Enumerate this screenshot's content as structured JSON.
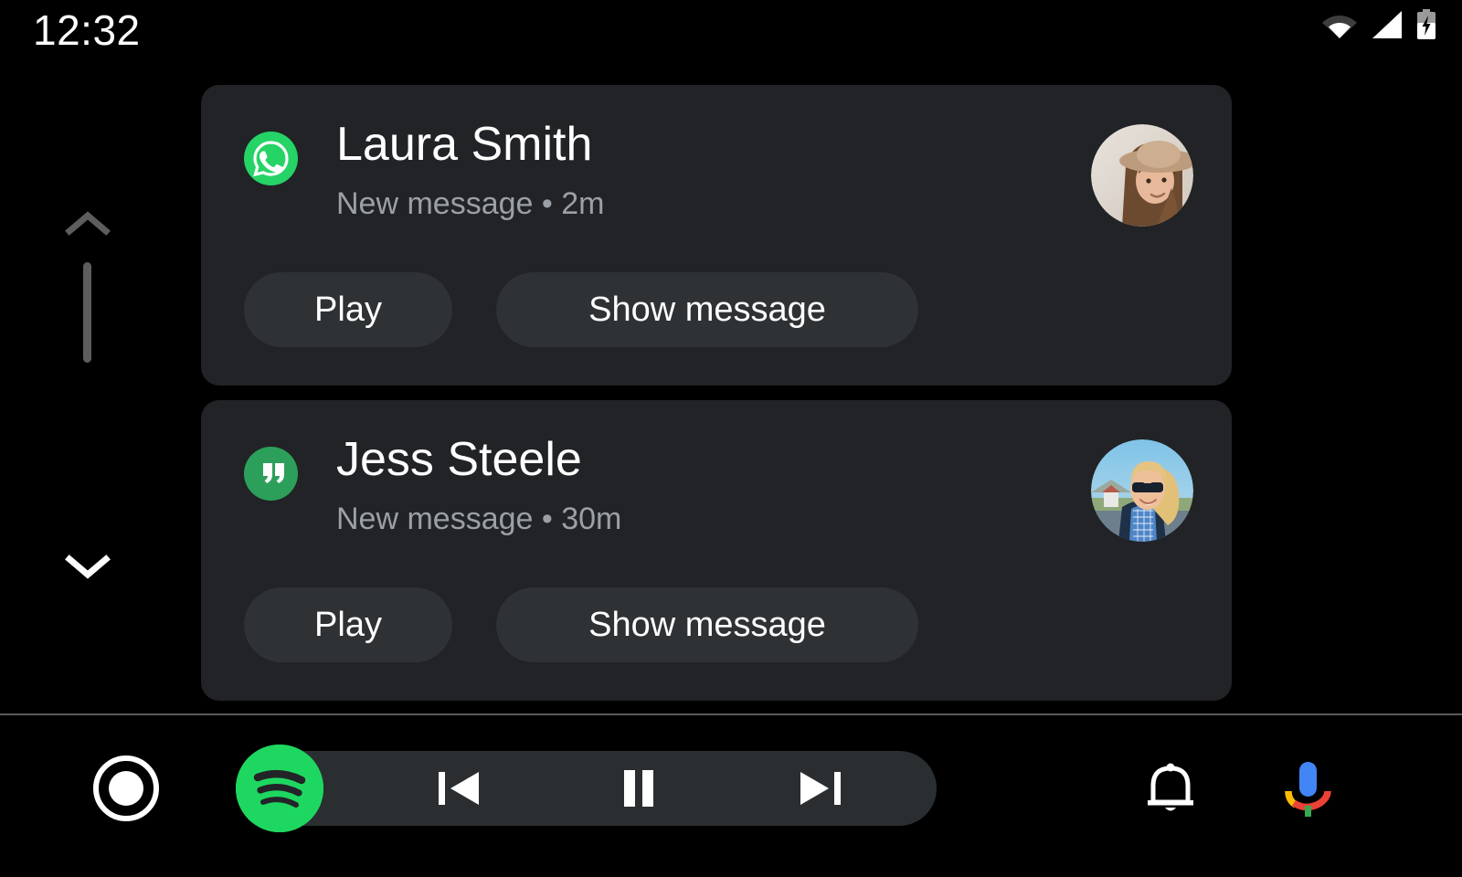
{
  "status_bar": {
    "clock": "12:32",
    "icons": [
      {
        "name": "wifi-icon",
        "label": "Wi-Fi"
      },
      {
        "name": "cellular-signal-icon",
        "label": "Cellular signal"
      },
      {
        "name": "battery-charging-icon",
        "label": "Battery charging"
      }
    ]
  },
  "scroll": {
    "up_label": "Scroll up",
    "down_label": "Scroll down"
  },
  "notifications": [
    {
      "app_icon": "whatsapp-icon",
      "app_color": "#25D366",
      "sender": "Laura Smith",
      "subline": "New message • 2m",
      "avatar": "laura-smith-avatar",
      "actions": [
        {
          "label": "Play",
          "name": "play-button"
        },
        {
          "label": "Show message",
          "name": "show-message-button"
        }
      ]
    },
    {
      "app_icon": "hangouts-icon",
      "app_color": "#2CA05A",
      "sender": "Jess Steele",
      "subline": "New message • 30m",
      "avatar": "jess-steele-avatar",
      "actions": [
        {
          "label": "Play",
          "name": "play-button"
        },
        {
          "label": "Show message",
          "name": "show-message-button"
        }
      ]
    }
  ],
  "nav_bar": {
    "home_label": "Home",
    "media_app": "Spotify",
    "media_app_color": "#1ED760",
    "controls": [
      {
        "name": "skip-previous-button",
        "label": "Previous"
      },
      {
        "name": "pause-button",
        "label": "Pause"
      },
      {
        "name": "skip-next-button",
        "label": "Next"
      }
    ],
    "notifications_label": "Notifications",
    "assistant_label": "Google Assistant"
  },
  "colors": {
    "background": "#000000",
    "card": "#212326",
    "button": "#2E3235",
    "primary_text": "#FFFFFF",
    "secondary_text": "#9AA0A6",
    "media_pill": "#2B2E31"
  }
}
